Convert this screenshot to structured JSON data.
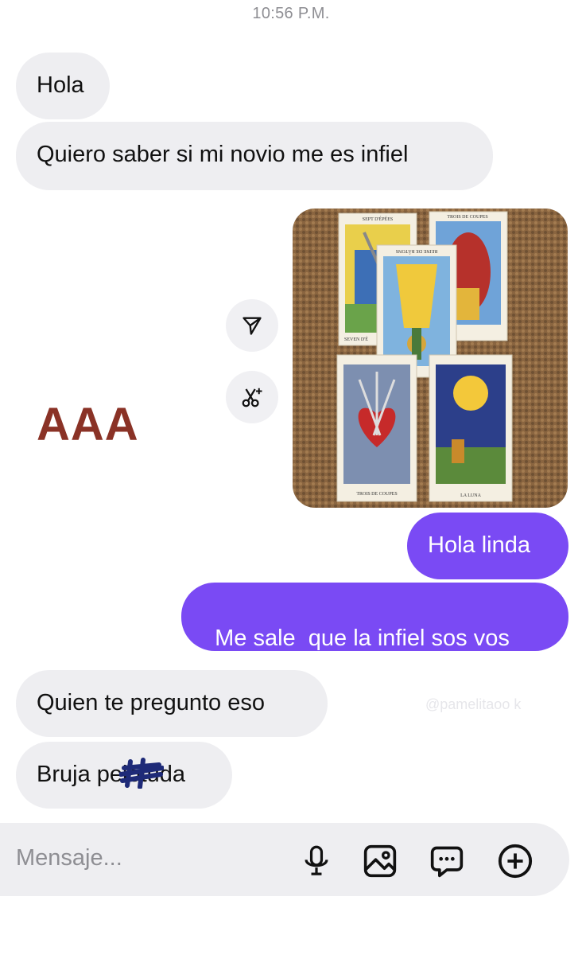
{
  "timestamp": "10:56 P.M.",
  "messages": [
    {
      "text": "Hola",
      "direction": "incoming"
    },
    {
      "text": "Quiero saber si mi novio me es infiel",
      "direction": "incoming"
    },
    {
      "text": "Hola linda",
      "direction": "outgoing"
    },
    {
      "text": "Me sale  que la infiel sos vos",
      "direction": "outgoing"
    },
    {
      "text": "Quien te pregunto eso",
      "direction": "incoming"
    }
  ],
  "last_message": {
    "prefix": "Bruja pe",
    "censored": "lot",
    "suffix": "uda",
    "direction": "incoming"
  },
  "photo": {
    "cards": [
      {
        "label": "SEVEN D'É",
        "top_label": "SEPT D'ÉPÉES"
      },
      {
        "label": "TROIS DE COUPES"
      },
      {
        "label": "REINE DE BÂTONS"
      },
      {
        "label": "TROIS DE COUPES"
      },
      {
        "label": "LA LUNA"
      }
    ]
  },
  "overlay_text": "AAA",
  "watermark": "@pamelitaoo k",
  "composer": {
    "placeholder": "Mensaje...",
    "icons": [
      "microphone-icon",
      "image-icon",
      "chat-bubble-icon",
      "plus-circle-icon"
    ]
  },
  "image_actions": [
    "share-icon",
    "scissors-icon"
  ],
  "colors": {
    "outgoing_bubble": "#7a4af4",
    "incoming_bubble": "#eeeef1",
    "overlay_text": "#8a3226"
  }
}
